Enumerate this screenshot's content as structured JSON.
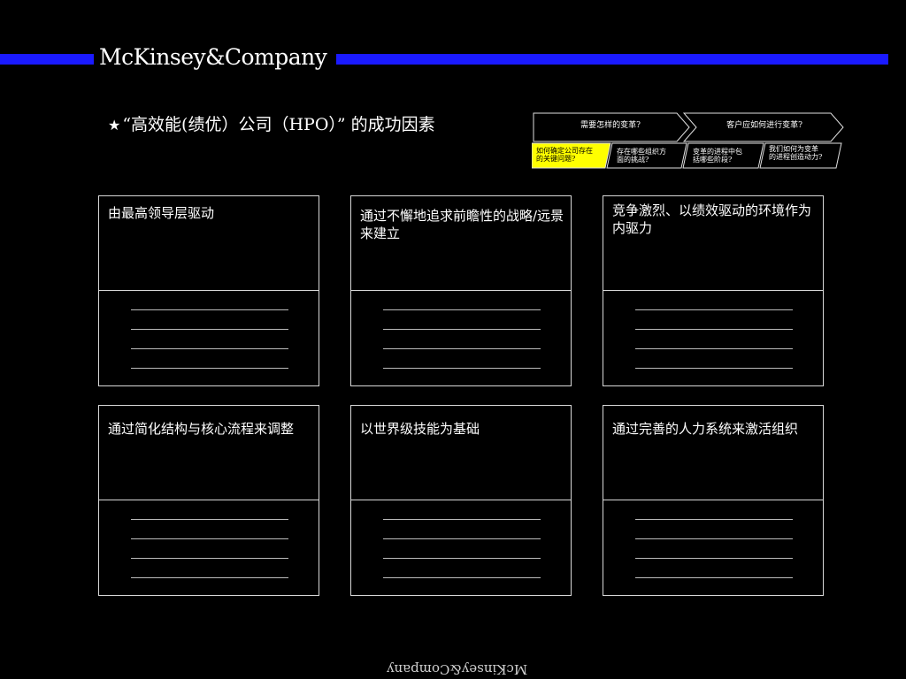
{
  "brand": {
    "logo_text": "McKinsey&Company",
    "footer_logo_text": "McKinsey&Company"
  },
  "title": {
    "star": "★",
    "text": "“高效能(绩优）公司（HPO）” 的成功因素"
  },
  "nav": {
    "top": [
      "需要怎样的变革?",
      "客户应如何进行变革?"
    ],
    "sub": [
      {
        "line1": "如何确定公司存在",
        "line2": "的关键问题?"
      },
      {
        "line1": "存在哪些组织方",
        "line2": "面的挑战?"
      },
      {
        "line1": "变革的进程中包",
        "line2": "括哪些阶段?"
      },
      {
        "line1": "我们如何为变革",
        "line2": "的进程创造动力?"
      }
    ],
    "highlight_color": "#ffff00"
  },
  "cards": [
    {
      "label": "由最高领导层驱动"
    },
    {
      "label": " 通过不懈地追求前瞻性的战略/远景来建立"
    },
    {
      "label": "竞争激烈、以绩效驱动的环境作为内驱力"
    },
    {
      "label": "通过简化结构与核心流程来调整"
    },
    {
      "label": "以世界级技能为基础"
    },
    {
      "label": " 通过完善的人力系统来激活组织"
    }
  ],
  "colors": {
    "band": "#1a1aff",
    "background": "#000000"
  }
}
